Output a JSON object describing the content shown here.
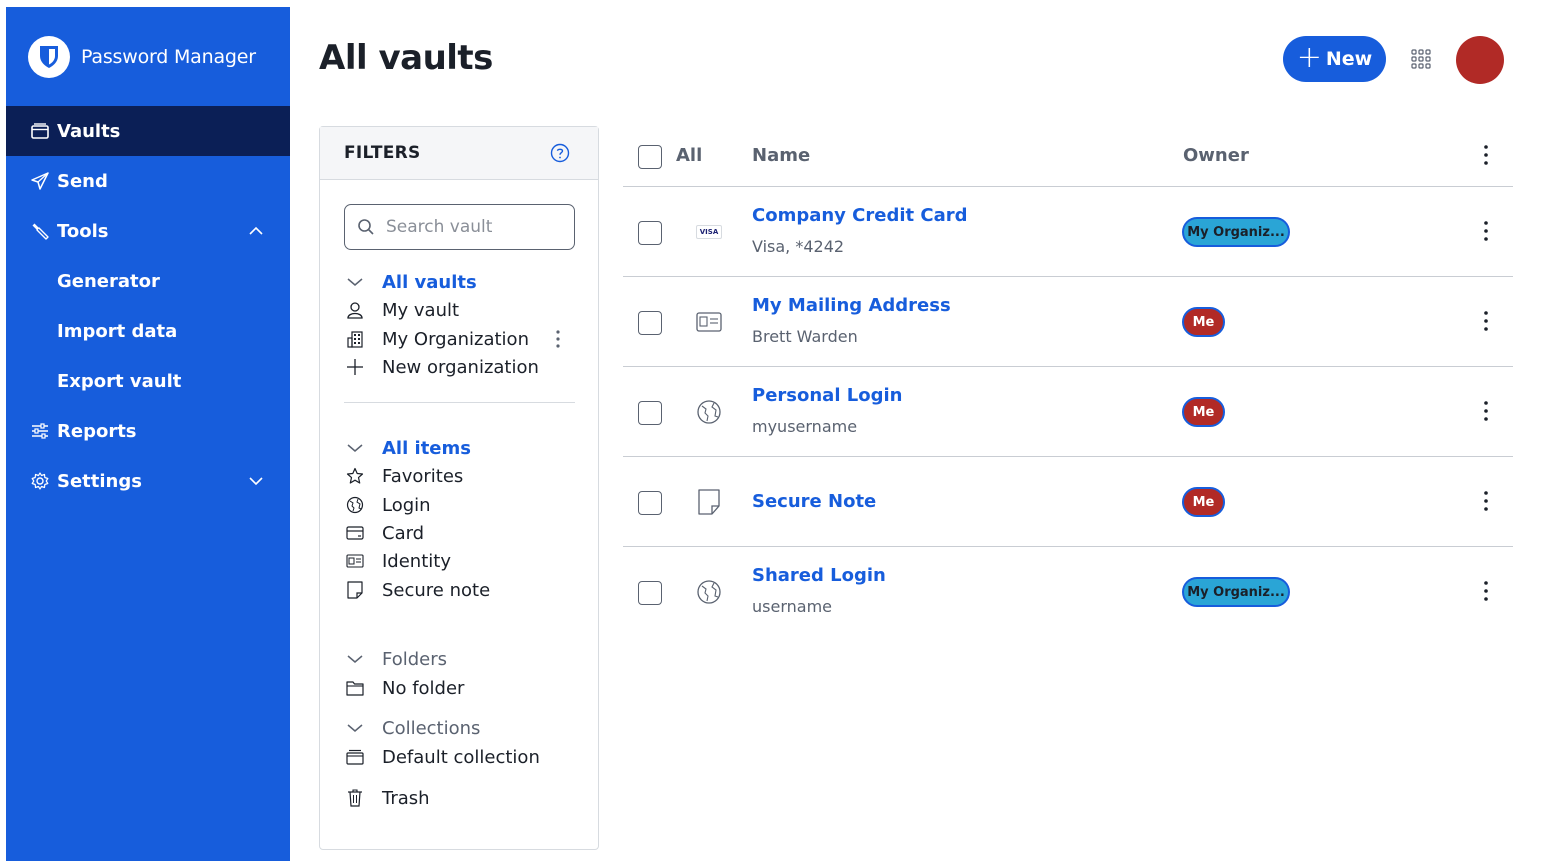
{
  "sidebar": {
    "brand": "Password Manager",
    "items": [
      {
        "label": "Vaults",
        "icon": "vault-icon"
      },
      {
        "label": "Send",
        "icon": "send-icon"
      },
      {
        "label": "Tools",
        "icon": "wrench-icon"
      },
      {
        "label": "Generator"
      },
      {
        "label": "Import data"
      },
      {
        "label": "Export vault"
      },
      {
        "label": "Reports",
        "icon": "sliders-icon"
      },
      {
        "label": "Settings",
        "icon": "gear-icon"
      }
    ]
  },
  "header": {
    "title": "All vaults",
    "new_label": "New"
  },
  "filters": {
    "title": "FILTERS",
    "search_placeholder": "Search vault",
    "vaults": [
      "All vaults",
      "My vault",
      "My Organization",
      "New organization"
    ],
    "types": [
      "All items",
      "Favorites",
      "Login",
      "Card",
      "Identity",
      "Secure note"
    ],
    "folders_label": "Folders",
    "no_folder": "No folder",
    "collections_label": "Collections",
    "default_collection": "Default collection",
    "trash": "Trash"
  },
  "table": {
    "col_all": "All",
    "col_name": "Name",
    "col_owner": "Owner",
    "rows": [
      {
        "name": "Company Credit Card",
        "sub": "Visa, *4242",
        "owner": "My Organiz...",
        "icon": "visa-card-icon"
      },
      {
        "name": "My Mailing Address",
        "sub": "Brett Warden",
        "owner": "Me",
        "icon": "identity-icon"
      },
      {
        "name": "Personal Login",
        "sub": "myusername",
        "owner": "Me",
        "icon": "globe-icon"
      },
      {
        "name": "Secure Note",
        "sub": "",
        "owner": "Me",
        "icon": "note-icon"
      },
      {
        "name": "Shared Login",
        "sub": "username",
        "owner": "My Organiz...",
        "icon": "globe-icon"
      }
    ]
  },
  "colors": {
    "brand_blue": "#175ddc",
    "active_nav": "#0b1f56",
    "avatar": "#b12a26",
    "org_badge": "#2aa5d6",
    "me_badge": "#b12a26"
  },
  "visa_text": "VISA"
}
